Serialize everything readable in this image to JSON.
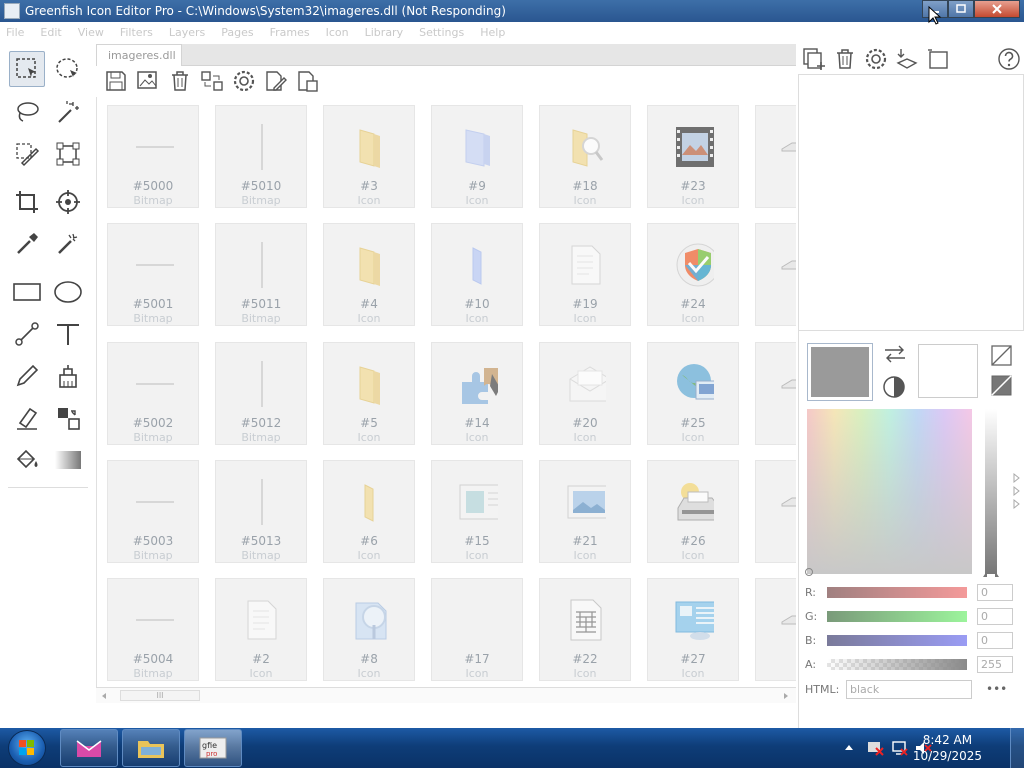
{
  "window": {
    "title": "Greenfish Icon Editor Pro - C:\\Windows\\System32\\imageres.dll (Not Responding)"
  },
  "menu": [
    "File",
    "Edit",
    "View",
    "Filters",
    "Layers",
    "Pages",
    "Frames",
    "Icon",
    "Library",
    "Settings",
    "Help"
  ],
  "tab": {
    "label": "imageres.dll"
  },
  "tiles": [
    {
      "name": "#5000",
      "kind": "Bitmap",
      "art": "hline"
    },
    {
      "name": "#5010",
      "kind": "Bitmap",
      "art": "vline"
    },
    {
      "name": "#3",
      "kind": "Icon",
      "art": "folder"
    },
    {
      "name": "#9",
      "kind": "Icon",
      "art": "bluefile"
    },
    {
      "name": "#18",
      "kind": "Icon",
      "art": "folder-search"
    },
    {
      "name": "#23",
      "kind": "Icon",
      "art": "film"
    },
    {
      "name": "#5001",
      "kind": "Bitmap",
      "art": "hline"
    },
    {
      "name": "#5011",
      "kind": "Bitmap",
      "art": "vline"
    },
    {
      "name": "#4",
      "kind": "Icon",
      "art": "folder"
    },
    {
      "name": "#10",
      "kind": "Icon",
      "art": "bluefile-thin"
    },
    {
      "name": "#19",
      "kind": "Icon",
      "art": "document"
    },
    {
      "name": "#24",
      "kind": "Icon",
      "art": "shield"
    },
    {
      "name": "#5002",
      "kind": "Bitmap",
      "art": "hline"
    },
    {
      "name": "#5012",
      "kind": "Bitmap",
      "art": "vline"
    },
    {
      "name": "#5",
      "kind": "Icon",
      "art": "folder"
    },
    {
      "name": "#14",
      "kind": "Icon",
      "art": "puzzle"
    },
    {
      "name": "#20",
      "kind": "Icon",
      "art": "envelope"
    },
    {
      "name": "#25",
      "kind": "Icon",
      "art": "globe"
    },
    {
      "name": "#5003",
      "kind": "Bitmap",
      "art": "hline"
    },
    {
      "name": "#5013",
      "kind": "Bitmap",
      "art": "vline"
    },
    {
      "name": "#6",
      "kind": "Icon",
      "art": "folder-thin"
    },
    {
      "name": "#15",
      "kind": "Icon",
      "art": "window"
    },
    {
      "name": "#21",
      "kind": "Icon",
      "art": "picture"
    },
    {
      "name": "#26",
      "kind": "Icon",
      "art": "printer"
    },
    {
      "name": "#5004",
      "kind": "Bitmap",
      "art": "hline"
    },
    {
      "name": "#2",
      "kind": "Icon",
      "art": "document"
    },
    {
      "name": "#8",
      "kind": "Icon",
      "art": "search-doc"
    },
    {
      "name": "#17",
      "kind": "Icon",
      "art": "empty"
    },
    {
      "name": "#22",
      "kind": "Icon",
      "art": "music-doc"
    },
    {
      "name": "#27",
      "kind": "Icon",
      "art": "screen"
    }
  ],
  "scrollbar": {
    "thumb_glyph": "III"
  },
  "color": {
    "foreground": "#9a9a9a",
    "background": "#ffffff",
    "r_label": "R:",
    "r_value": "0",
    "g_label": "G:",
    "g_value": "0",
    "b_label": "B:",
    "b_value": "0",
    "a_label": "A:",
    "a_value": "255",
    "html_label": "HTML:",
    "html_value": "black",
    "more_label": "•••"
  },
  "taskbar": {
    "time": "8:42 AM",
    "date": "10/29/2025"
  }
}
